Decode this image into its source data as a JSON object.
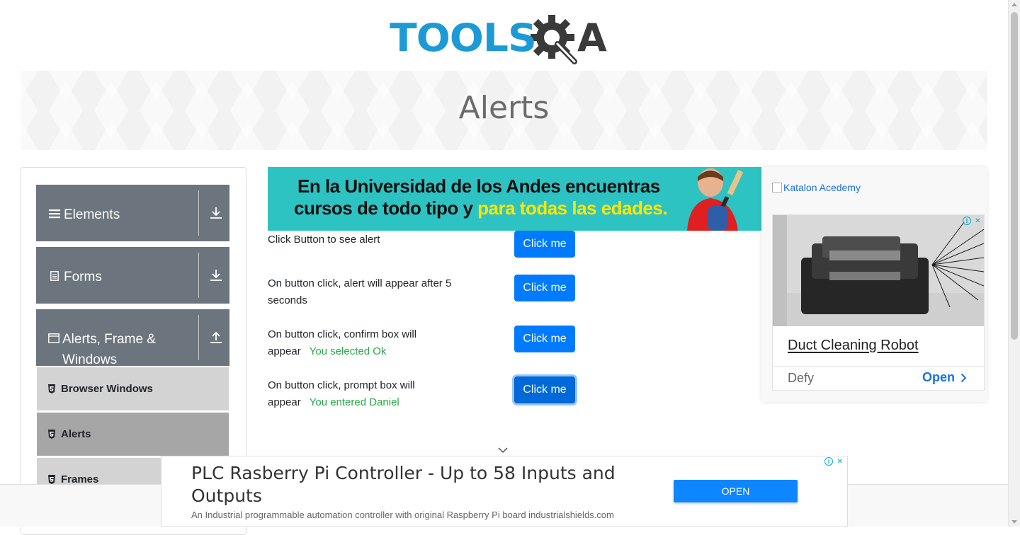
{
  "logo": {
    "tools": "TOOLS",
    "a": "A"
  },
  "page": {
    "title": "Alerts"
  },
  "sidebar": {
    "groups": [
      {
        "label": "Elements",
        "icon": "hamburger-icon",
        "arrow": "download-icon"
      },
      {
        "label": "Forms",
        "icon": "document-icon",
        "arrow": "download-icon"
      },
      {
        "label": "Alerts, Frame & Windows",
        "icon": "window-icon",
        "arrow": "upload-icon"
      }
    ],
    "subitems": [
      {
        "label": "Browser Windows",
        "active": false
      },
      {
        "label": "Alerts",
        "active": true
      },
      {
        "label": "Frames",
        "active": false
      }
    ]
  },
  "top_ad": {
    "line1": "En la Universidad de los Andes encuentras",
    "line2a": "cursos de todo tipo y ",
    "line2b": "para todas las edades."
  },
  "alerts": [
    {
      "text": "Click Button to see alert",
      "result": "",
      "button": "Click me"
    },
    {
      "text": "On button click, alert will appear after 5 seconds",
      "result": "",
      "button": "Click me"
    },
    {
      "text": "On button click, confirm box will appear",
      "result": "You selected Ok",
      "button": "Click me"
    },
    {
      "text": "On button click, prompt box will appear",
      "result": "You entered Daniel",
      "button": "Click me"
    }
  ],
  "right_ad": {
    "image_alt": "Katalon Acedemy",
    "headline": "Duct Cleaning Robot",
    "brand": "Defy",
    "cta": "Open"
  },
  "bottom_ad": {
    "title": "PLC Rasberry Pi Controller - Up to 58 Inputs and Outputs",
    "description": "An Industrial programmable automation controller with original Raspberry Pi board industrialshields.com",
    "cta": "OPEN"
  },
  "colors": {
    "primary": "#007bff",
    "success": "#28a745",
    "sidebar_group": "#6c757d",
    "logo_blue": "#1d9ad6",
    "logo_dark": "#3a3a3a"
  }
}
